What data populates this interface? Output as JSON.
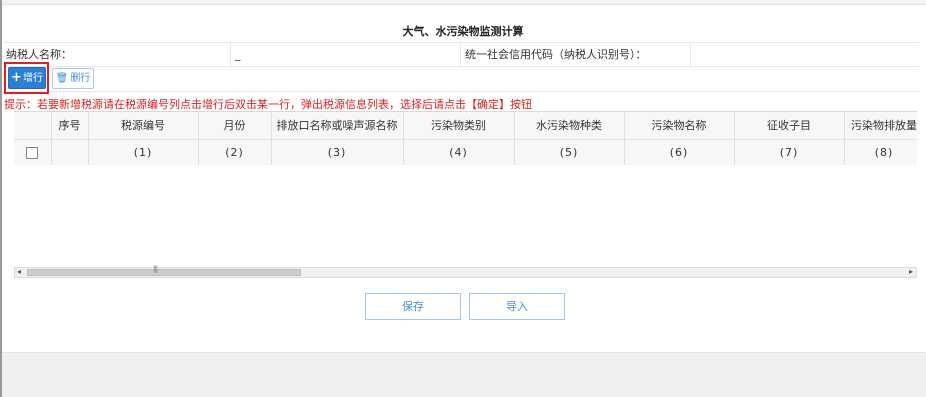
{
  "title": "大气、水污染物监测计算",
  "taxpayer": {
    "name_label": "纳税人名称：",
    "name_value": "_",
    "code_label": "统一社会信用代码（纳税人识别号）："
  },
  "toolbar": {
    "add_label": "增行",
    "delete_label": "删行"
  },
  "hint": "提示：若要新增税源请在税源编号列点击增行后双击某一行，弹出税源信息列表，选择后请点击【确定】按钮",
  "table": {
    "headers": [
      "序号",
      "税源编号",
      "月份",
      "排放口名称或噪声源名称",
      "污染物类别",
      "水污染物种类",
      "污染物名称",
      "征收子目",
      "污染物排放量"
    ],
    "sub_headers": [
      "(1)",
      "(2)",
      "(3)",
      "(4)",
      "(5)",
      "(6)",
      "(7)",
      "(8)"
    ]
  },
  "scrollbar": {
    "left_arrow": "◂",
    "right_arrow": "▸",
    "grip": "|||"
  },
  "actions": {
    "save_label": "保存",
    "import_label": "导入"
  },
  "colors": {
    "accent_blue": "#2b7fd4",
    "hint_red": "#e02020",
    "highlight_red": "#e02020"
  },
  "icons": {
    "add": "plus-icon",
    "delete": "trash-icon"
  }
}
